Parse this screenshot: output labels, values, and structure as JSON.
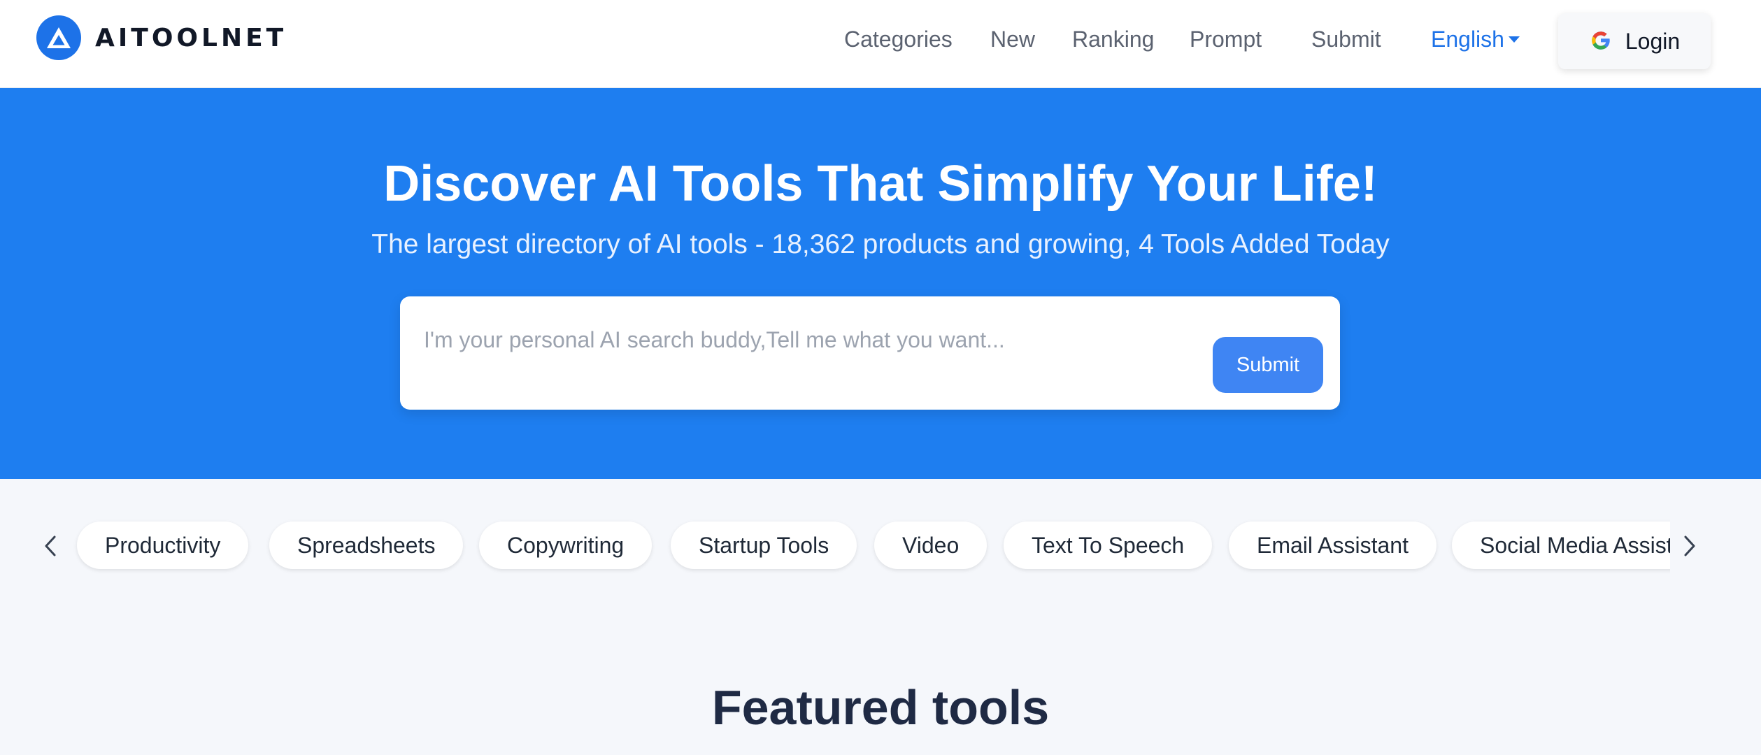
{
  "header": {
    "logo_text": "AITOOLNET",
    "nav": {
      "categories": "Categories",
      "new": "New",
      "ranking": "Ranking",
      "prompt": "Prompt",
      "submit": "Submit"
    },
    "language": "English",
    "login_label": "Login"
  },
  "hero": {
    "title": "Discover AI Tools That Simplify Your Life!",
    "subtitle": "The largest directory of AI tools - 18,362 products and growing, 4 Tools Added Today",
    "search": {
      "placeholder": "I'm your personal AI search buddy,Tell me what you want...",
      "value": "",
      "submit_label": "Submit"
    }
  },
  "categories": {
    "items": [
      "Productivity",
      "Spreadsheets",
      "Copywriting",
      "Startup Tools",
      "Video",
      "Text To Speech",
      "Email Assistant",
      "Social Media Assistant"
    ],
    "prev_icon": "chevron-left-icon",
    "next_icon": "chevron-right-icon"
  },
  "featured": {
    "heading": "Featured tools"
  },
  "colors": {
    "brand_blue": "#1e7ef0",
    "button_blue": "#3f85f3",
    "link_blue": "#1d72e8"
  }
}
